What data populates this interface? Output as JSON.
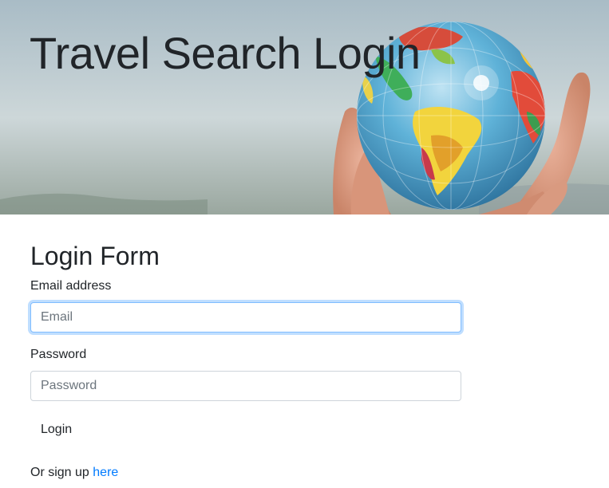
{
  "hero": {
    "title": "Travel Search Login",
    "image_name": "globe-in-hand-image"
  },
  "form": {
    "heading": "Login Form",
    "email_label": "Email address",
    "email_placeholder": "Email",
    "email_value": "",
    "password_label": "Password",
    "password_placeholder": "Password",
    "password_value": "",
    "login_button": "Login"
  },
  "signup": {
    "prefix": "Or sign up",
    "link_text": "here"
  },
  "colors": {
    "link": "#007bff",
    "focus_border": "#80bdff",
    "text": "#212529"
  }
}
